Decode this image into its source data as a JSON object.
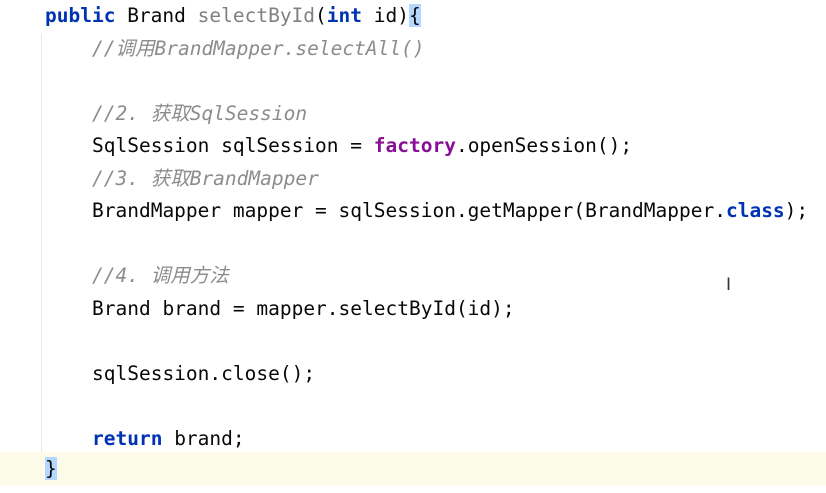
{
  "code": {
    "l1": {
      "kw1": "public",
      "t1": " Brand ",
      "fn": "selectById",
      "t2": "(",
      "kw2": "int",
      "t3": " id)",
      "brace": "{"
    },
    "l2": {
      "comment": "//调用BrandMapper.selectAll()"
    },
    "l3": {
      "comment": "//2. 获取SqlSession"
    },
    "l4": {
      "t1": "SqlSession sqlSession = ",
      "field": "factory",
      "t2": ".openSession();"
    },
    "l5": {
      "comment": "//3. 获取BrandMapper"
    },
    "l6": {
      "t1": "BrandMapper mapper = sqlSession.getMapper(BrandMapper.",
      "kw": "class",
      "t2": ");"
    },
    "l7": {
      "comment": "//4. 调用方法"
    },
    "l8": {
      "t1": "Brand brand = mapper.selectById(id);"
    },
    "l9": {
      "t1": "sqlSession.close();"
    },
    "l10": {
      "kw": "return",
      "t1": " brand;"
    },
    "l11": {
      "brace": "}"
    }
  },
  "cursor": {
    "glyph": "I"
  }
}
